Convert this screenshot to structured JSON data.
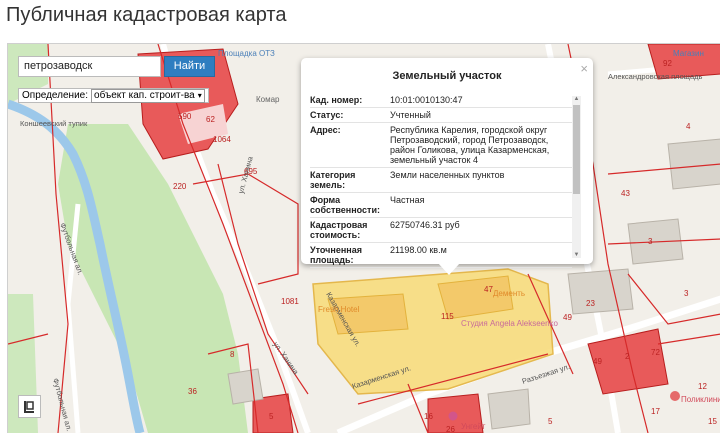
{
  "page": {
    "title": "Публичная кадастровая карта"
  },
  "search": {
    "value": "петрозаводск",
    "button_label": "Найти"
  },
  "definition": {
    "label": "Определение:",
    "selected": "объект кап. строит-ва"
  },
  "popup": {
    "title": "Земельный участок",
    "close": "×",
    "rows": [
      {
        "key": "Кад. номер:",
        "value": "10:01:0010130:47"
      },
      {
        "key": "Статус:",
        "value": "Учтенный"
      },
      {
        "key": "Адрес:",
        "value": "Республика Карелия, городской округ Петрозаводский, город Петрозаводск, район Голикова, улица Казарменская, земельный участок 4"
      },
      {
        "key": "Категория земель:",
        "value": "Земли населенных пунктов"
      },
      {
        "key": "Форма собственности:",
        "value": "Частная"
      },
      {
        "key": "Кадастровая стоимость:",
        "value": "62750746.31 руб"
      },
      {
        "key": "Уточненная площадь:",
        "value": "21198.00 кв.м"
      }
    ]
  },
  "map": {
    "labels": {
      "l590": "590",
      "l62": "62",
      "l1064": "1064",
      "l220": "220",
      "l695": "695",
      "l1081": "1081",
      "l8": "8",
      "l36": "36",
      "l43": "43",
      "l3": "3",
      "l23": "23",
      "l49": "49",
      "l47": "47",
      "l115": "115",
      "l2": "2",
      "l72": "72",
      "l17": "17",
      "l16": "16",
      "l26": "26",
      "l5": "5",
      "l92": "92",
      "l4": "4",
      "l5b": "5",
      "l12": "12",
      "l15": "15",
      "l49b": "49",
      "l3b": "3"
    },
    "streets": {
      "football": "Футбольная ал.",
      "football2": "Футбольная ал.",
      "kazarm": "Казарменская ул.",
      "kazarm2": "Казарменская ул.",
      "khanin": "ул. Ханина",
      "ul_khanina": "ул. Ханина",
      "raz": "Разъезжая ул.",
      "ploshchad": "Александровская площадь",
      "konsh": "Коншеевский тупик"
    },
    "pois": {
      "otz": "Площадка ОТЗ",
      "komar": "Комар",
      "magaz": "Магазин",
      "hotel": "Fresh Hotel",
      "studio": "Студия Angela Alekseenko",
      "poly": "Поликлиника № 2",
      "ungeit": "Унгейт",
      "dement": "Дементь"
    }
  }
}
